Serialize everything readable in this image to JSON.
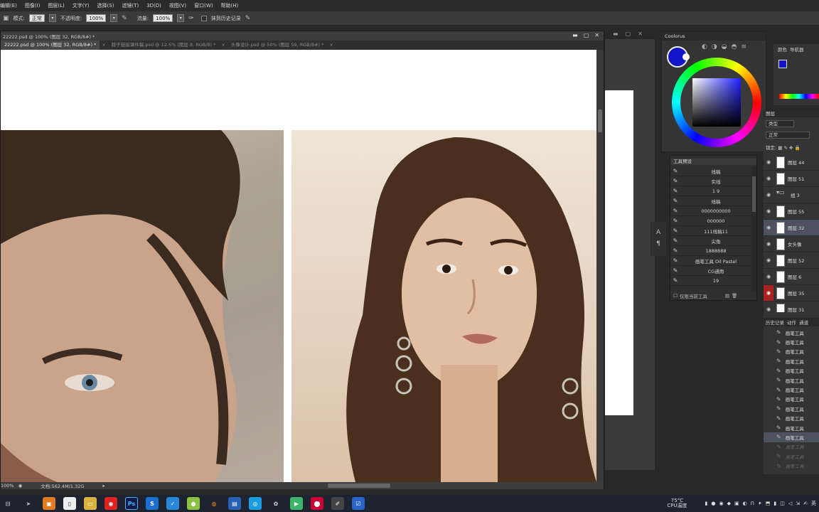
{
  "menu": [
    "编辑(E)",
    "图像(I)",
    "图层(L)",
    "文字(Y)",
    "选择(S)",
    "滤镜(T)",
    "3D(D)",
    "视图(V)",
    "窗口(W)",
    "帮助(H)"
  ],
  "options": {
    "mode_label": "模式:",
    "mode_value": "正常",
    "opacity_label": "不透明度:",
    "opacity_value": "100%",
    "flow_label": "流量:",
    "flow_value": "100%",
    "history_label": "抹到历史记录"
  },
  "document": {
    "title": "22222.psd @ 100% (图层 32, RGB/8#) *",
    "tabs": [
      {
        "label": "22222.psd @ 100% (图层 32, RGB/8#) *",
        "active": true
      },
      {
        "label": "脖子链接课件稿.psd @ 12.5% (图层 8, RGB/8) *",
        "active": false
      },
      {
        "label": "头像设计.psd @ 50% (图层 59, RGB/8#) *",
        "active": false
      }
    ],
    "zoom": "100%",
    "doc_size": "文档:562.4M/1.32G"
  },
  "color_panel": {
    "title": "Coolorus",
    "fg_color": "#1414c8"
  },
  "presets": {
    "title": "工具预设",
    "items": [
      "线稿",
      "实线",
      "1 9",
      "线稿",
      "0000000000",
      "000000",
      "111线稿11",
      "尖角",
      "1888888",
      "画笔工具 Oil Pastel",
      "CG通用",
      "19"
    ],
    "footer": "仅限当前工具"
  },
  "right_top": {
    "tabs": [
      "颜色",
      "导航器"
    ]
  },
  "layers": {
    "title": "图层",
    "kind": "类型",
    "mode": "正常",
    "lock_label": "锁定:",
    "items": [
      {
        "name": "图层 44",
        "type": "layer"
      },
      {
        "name": "图层 51",
        "type": "layer"
      },
      {
        "name": "组 3",
        "type": "group"
      },
      {
        "name": "图层 55",
        "type": "layer"
      },
      {
        "name": "图层 32",
        "type": "layer",
        "selected": true
      },
      {
        "name": "女头像",
        "type": "layer"
      },
      {
        "name": "图层 52",
        "type": "layer"
      },
      {
        "name": "图层 6",
        "type": "layer"
      },
      {
        "name": "图层 35",
        "type": "layer",
        "hidden": true
      },
      {
        "name": "图层 31",
        "type": "layer"
      }
    ]
  },
  "history": {
    "tabs": [
      "历史记录",
      "动作",
      "通道"
    ],
    "items": [
      "画笔工具",
      "画笔工具",
      "画笔工具",
      "画笔工具",
      "画笔工具",
      "画笔工具",
      "画笔工具",
      "画笔工具",
      "画笔工具",
      "画笔工具",
      "画笔工具",
      "画笔工具",
      "画笔工具",
      "画笔工具",
      "画笔工具"
    ],
    "current_index": 11,
    "dim_from": 12
  },
  "taskbar": {
    "temperature": "75°C",
    "cpu_label": "CPU温度",
    "ime": "英"
  }
}
